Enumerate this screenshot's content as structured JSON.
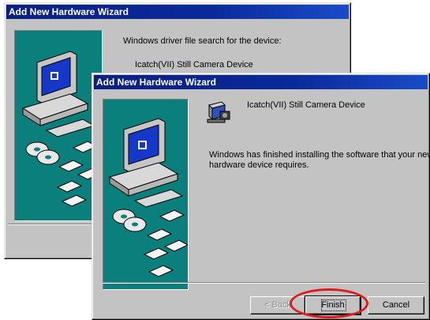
{
  "back_window": {
    "title": "Add New Hardware Wizard",
    "search_text": "Windows driver file search for the device:",
    "device_name": "Icatch(VII) Still Camera Device"
  },
  "front_window": {
    "title": "Add New Hardware Wizard",
    "device_name": "Icatch(VII) Still Camera Device",
    "finish_message_line1": "Windows has finished installing the software that your new",
    "finish_message_line2": "hardware device requires.",
    "device_icon": "camera-icon"
  },
  "buttons": {
    "back_label": "< Back",
    "finish_label": "Finish",
    "cancel_label": "Cancel"
  },
  "annotation": {
    "highlight_color": "#e01a1a",
    "target": "finish-button"
  },
  "icons": {
    "wizard_art": "computer-with-discs-illustration"
  }
}
